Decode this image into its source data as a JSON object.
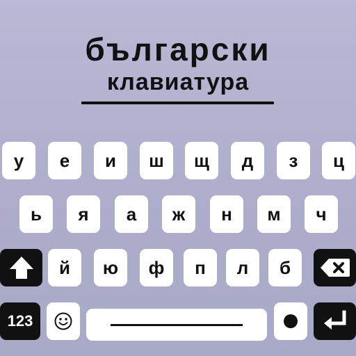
{
  "header": {
    "title": "български",
    "subtitle": "клавиатура"
  },
  "keyboard": {
    "row1": [
      "у",
      "е",
      "и",
      "ш",
      "щ",
      "д",
      "з",
      "ц"
    ],
    "row2": [
      "ь",
      "я",
      "а",
      "ж",
      "н",
      "м",
      "ч"
    ],
    "row3": [
      "й",
      "ю",
      "ф",
      "п",
      "л",
      "б"
    ],
    "numbers_label": "123",
    "icons": {
      "shift": "shift-arrow-icon",
      "backspace": "backspace-icon",
      "emoji": "emoji-icon",
      "dot": "dot-icon",
      "enter": "enter-icon"
    }
  },
  "colors": {
    "background": "#b6b6d3",
    "key": "#ffffff",
    "dark_key": "#111111",
    "text": "#111111"
  }
}
